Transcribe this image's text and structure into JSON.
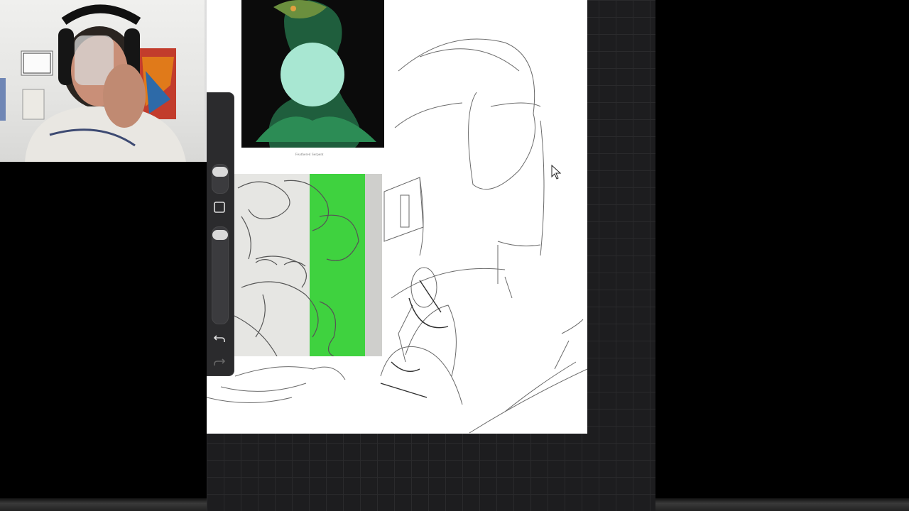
{
  "reference": {
    "caption": "Feathered Serpent"
  },
  "sidebar": {
    "brush_size": 0.85,
    "opacity": 0.9,
    "modify_button_icon": "square-icon",
    "undo_icon": "undo-arrow-icon",
    "redo_icon": "redo-arrow-icon"
  },
  "colors": {
    "workspace": "#1d1d1f",
    "sidebar": "#2b2b2d",
    "canvas": "#ffffff"
  }
}
